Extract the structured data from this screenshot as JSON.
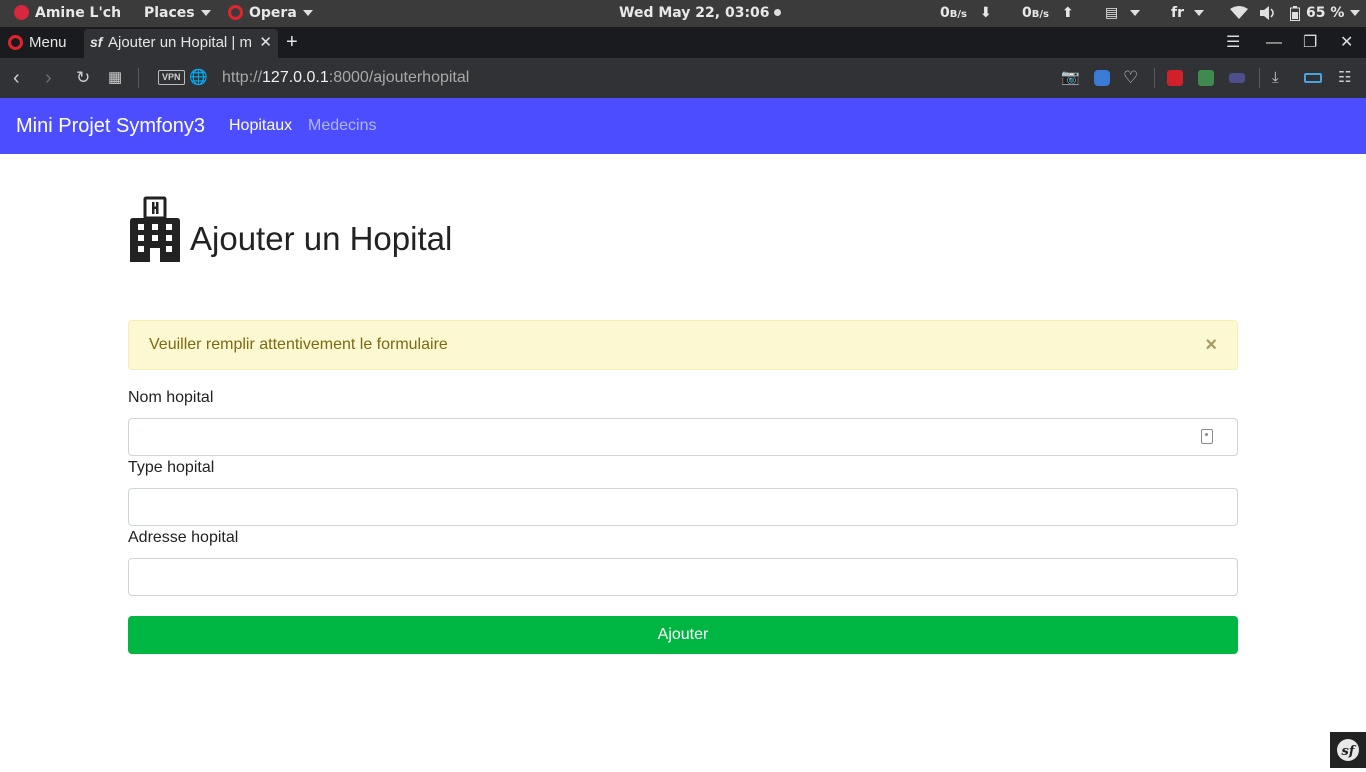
{
  "system_bar": {
    "user": "Amine L'ch",
    "places": "Places",
    "app": "Opera",
    "datetime": "Wed May 22, 03:06",
    "net_down_value": "0",
    "net_down_unit": "B/s",
    "net_up_value": "0",
    "net_up_unit": "B/s",
    "language": "fr",
    "battery": "65 %"
  },
  "browser": {
    "menu_label": "Menu",
    "tab_title": "Ajouter un Hopital | m",
    "tab_favicon": "sf",
    "vpn_badge": "VPN",
    "url_scheme": "http://",
    "url_host": "127.0.0.1",
    "url_rest": ":8000/ajouterhopital"
  },
  "navbar": {
    "brand": "Mini Projet Symfony3",
    "links": [
      "Hopitaux",
      "Medecins"
    ],
    "active_color": "#ffffff",
    "inactive_color": "#b4b6ff",
    "background": "#4b4dff"
  },
  "page": {
    "title": "Ajouter un Hopital",
    "title_icon": "hospital-building-icon",
    "alert_text": "Veuiller remplir attentivement le formulaire",
    "alert_close": "×",
    "fields": [
      {
        "label": "Nom hopital",
        "value": ""
      },
      {
        "label": "Type hopital",
        "value": ""
      },
      {
        "label": "Adresse hopital",
        "value": ""
      }
    ],
    "submit_label": "Ajouter",
    "submit_color": "#00b642"
  }
}
